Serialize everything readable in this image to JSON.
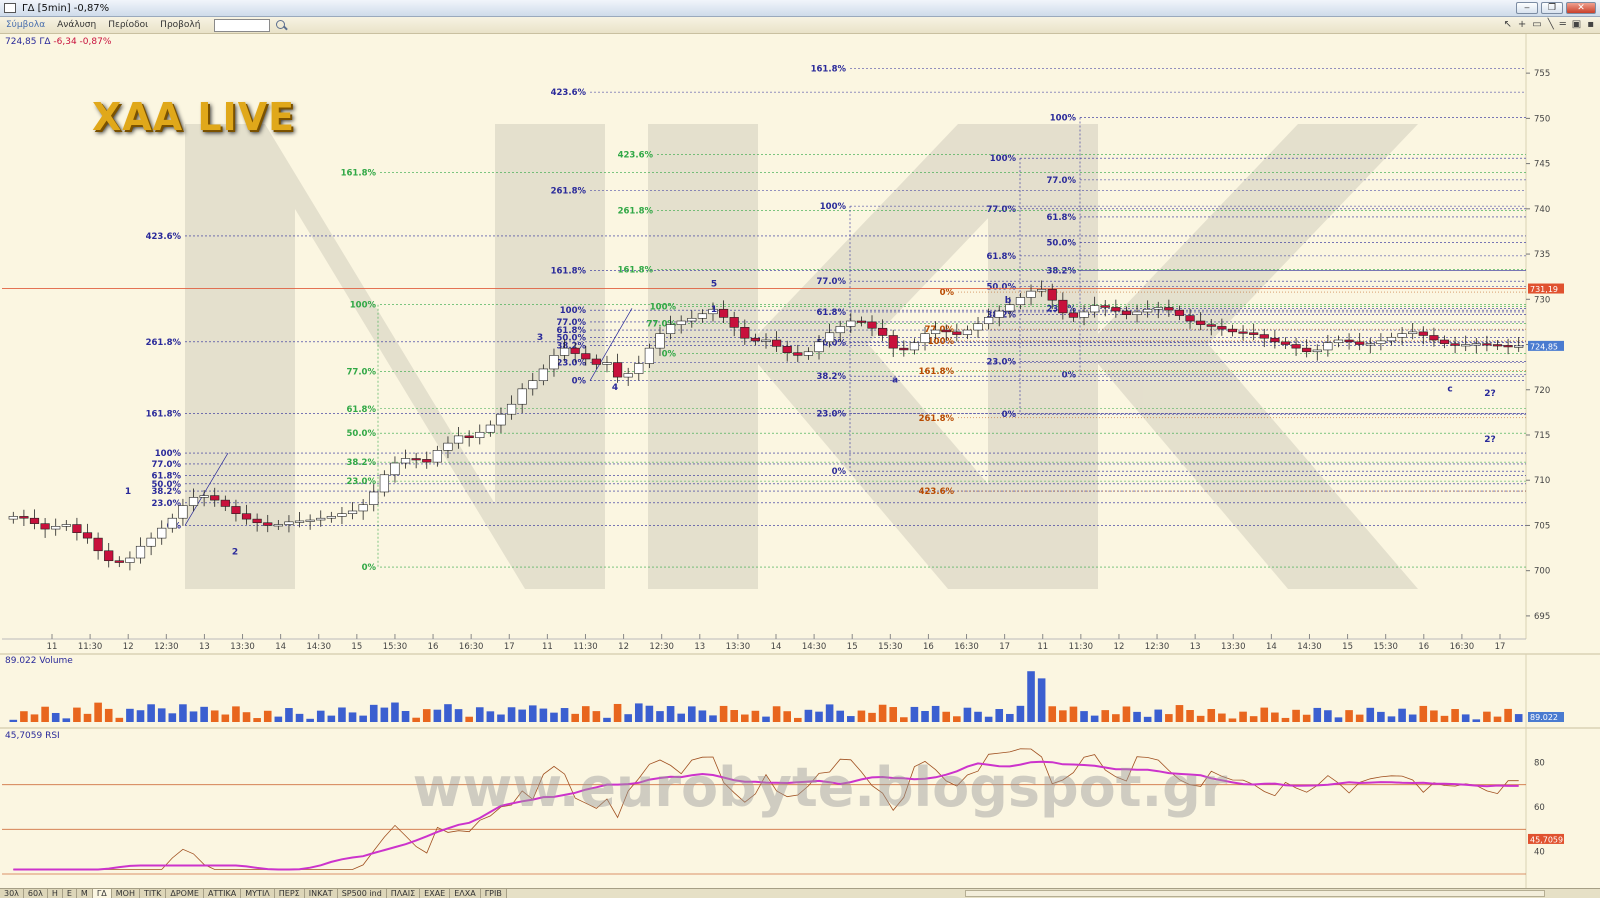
{
  "window": {
    "title": "ΓΔ [5min] -0,87%"
  },
  "menu": {
    "items": [
      "Σύμβολα",
      "Ανάλυση",
      "Περίοδοι",
      "Προβολή"
    ],
    "search_value": ""
  },
  "price_panel": {
    "symbol_line": "724,85 ΓΔ",
    "change_line": "-6,34 -0,87%"
  },
  "overlay": {
    "logo_text": "XAA LIVE",
    "watermark": "www.eurobyte.blogspot.gr"
  },
  "colors": {
    "up": "#ffffff",
    "down": "#c8103c",
    "fib_blue": "#2a2a9a",
    "fib_green": "#31a846",
    "fib_orange": "#b84a00",
    "rsi": "#cc33cc",
    "background": "#fbf6e1"
  },
  "chart_data": [
    {
      "type": "candlestick",
      "title": "ΓΔ 5min",
      "ylim": [
        693,
        758
      ],
      "y_ticks": [
        695,
        700,
        705,
        710,
        715,
        720,
        725,
        730,
        735,
        740,
        745,
        750,
        755
      ],
      "x_tick_labels": [
        "11",
        "11:30",
        "12",
        "12:30",
        "13",
        "13:30",
        "14",
        "14:30",
        "15",
        "15:30",
        "16",
        "16:30",
        "17",
        "11",
        "11:30",
        "12",
        "12:30",
        "13",
        "13:30",
        "14",
        "14:30",
        "15",
        "15:30",
        "16",
        "16:30",
        "17",
        "11",
        "11:30",
        "12",
        "12:30",
        "13",
        "13:30",
        "14",
        "14:30",
        "15",
        "15:30",
        "16",
        "16:30",
        "17"
      ],
      "last_price_label": "724,85",
      "hline_label": "731,19",
      "close_series": [
        706.0,
        705.8,
        705.2,
        704.6,
        704.9,
        705.1,
        704.2,
        703.6,
        702.2,
        701.1,
        700.9,
        701.4,
        702.7,
        703.6,
        704.7,
        705.8,
        707.2,
        708.1,
        708.3,
        707.8,
        707.1,
        706.3,
        705.7,
        705.3,
        705.0,
        705.1,
        705.4,
        705.5,
        705.6,
        705.8,
        706.0,
        706.3,
        706.6,
        707.3,
        708.7,
        710.6,
        711.9,
        712.4,
        712.3,
        712.0,
        713.3,
        714.1,
        714.9,
        714.7,
        715.3,
        716.1,
        717.3,
        718.4,
        720.1,
        721.0,
        722.3,
        723.8,
        724.6,
        724.0,
        723.4,
        722.8,
        723.0,
        721.4,
        721.8,
        722.9,
        724.6,
        726.2,
        727.2,
        727.6,
        727.9,
        728.4,
        728.9,
        728.0,
        726.9,
        725.7,
        725.4,
        725.5,
        724.8,
        724.1,
        723.8,
        724.2,
        725.3,
        726.3,
        727.0,
        727.6,
        727.5,
        726.8,
        726.0,
        724.6,
        724.4,
        725.2,
        726.2,
        726.6,
        726.4,
        726.1,
        726.6,
        727.3,
        728.0,
        728.7,
        729.4,
        730.2,
        730.9,
        731.1,
        729.9,
        728.5,
        728.0,
        728.6,
        729.3,
        729.1,
        728.7,
        728.3,
        728.6,
        728.9,
        729.1,
        728.8,
        728.2,
        727.6,
        727.2,
        727.0,
        726.7,
        726.4,
        726.3,
        726.1,
        725.7,
        725.3,
        725.0,
        724.6,
        724.2,
        724.4,
        725.2,
        725.5,
        725.3,
        725.0,
        725.1,
        725.4,
        725.8,
        726.2,
        726.4,
        726.0,
        725.5,
        725.1,
        724.9,
        725.0,
        725.1,
        725.0,
        724.9,
        724.8,
        724.85
      ],
      "fib_labels": [
        "161.8%",
        "423.6%",
        "161.8%",
        "423.6%",
        "261.8%",
        "100%",
        "100%",
        "77.0%",
        "61.8%",
        "50.0%",
        "38.2%",
        "23.0%",
        "0%",
        "261.8%",
        "423.6%",
        "261.8%",
        "161.8%",
        "161.8%",
        "100%",
        "77.0%",
        "61.8%",
        "50.0%",
        "38.2%",
        "23.0%",
        "0%",
        "161.8%",
        "77.0%",
        "61.8%",
        "50.0%",
        "38.2%",
        "23.0%",
        "0%",
        "161.8%",
        "100%",
        "77.0%",
        "61.8%",
        "50.0%",
        "38.2%",
        "23.0%",
        "0%",
        "100%",
        "77.0%",
        "61.8%",
        "50.0%",
        "38.2%",
        "23.0%",
        "0%",
        "100%",
        "77.0%",
        "61.8%",
        "50.0%",
        "38.2%",
        "23.0%",
        "0%",
        "0%",
        "77.0%",
        "100%",
        "161.8%",
        "261.8%",
        "423.6%"
      ],
      "wave_labels": [
        "1",
        "2",
        "3",
        "4",
        "1",
        "5",
        "a",
        "b",
        "c",
        "2?",
        "2?"
      ]
    },
    {
      "type": "bar",
      "title": "Volume",
      "header_value": "89.022",
      "last_value_label": "89.022"
    },
    {
      "type": "line",
      "title": "RSI",
      "header_value": "45,7059",
      "last_value_label": "45,7059",
      "ylim": [
        30,
        90
      ],
      "y_ticks": [
        40,
        60,
        80
      ],
      "levels": [
        30,
        50,
        70
      ]
    }
  ],
  "tabs": [
    "30λ",
    "60λ",
    "Η",
    "Ε",
    "Μ",
    "ΓΔ",
    "ΜΟΗ",
    "ΤΙΤΚ",
    "ΔΡΟΜΕ",
    "ΑΤΤΙΚΑ",
    "ΜΥΤΙΛ",
    "ΠΕΡΣ",
    "ΙΝΚΑΤ",
    "SP500 ind",
    "ΠΛΑΙΣ",
    "ΕΧΑΕ",
    "ΕΛΧΑ",
    "ΓΡΙΒ"
  ],
  "active_tab": "ΓΔ"
}
